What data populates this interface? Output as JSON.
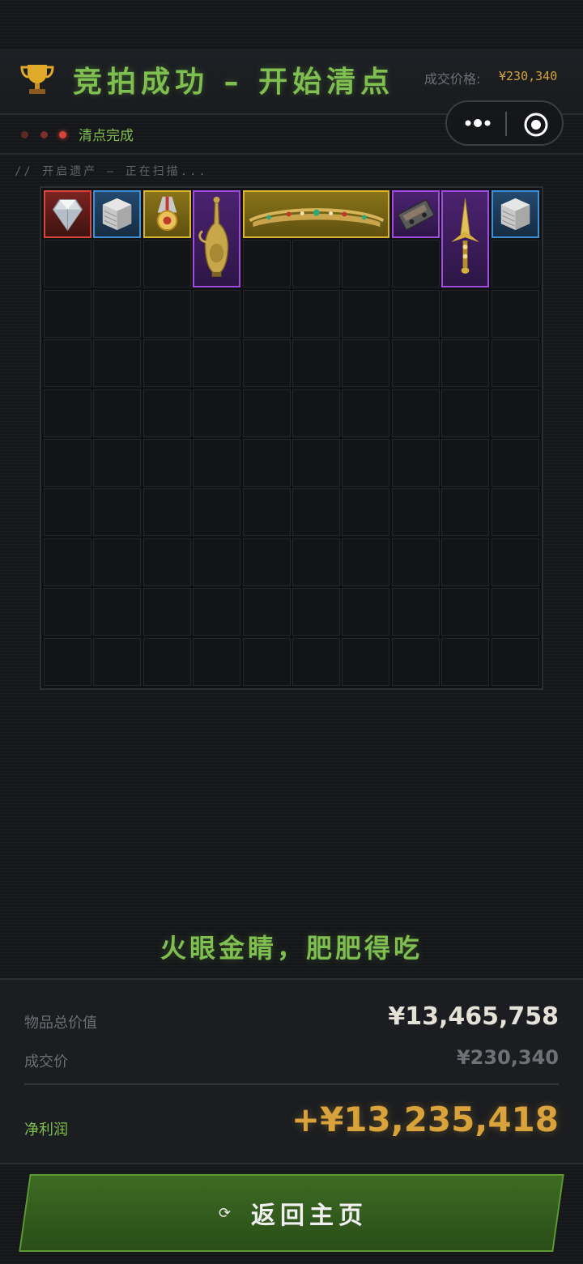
{
  "header": {
    "title": "竞拍成功 – 开始清点",
    "price_label": "成交价格:",
    "price_value": "¥230,340",
    "trophy_icon": "trophy-icon"
  },
  "capsule": {
    "more_icon": "more-dots-icon",
    "target_icon": "target-icon"
  },
  "status": {
    "text": "清点完成",
    "dots": [
      "#5a2a28",
      "#7a2f2b",
      "#d8443a"
    ]
  },
  "scan_text": "//  开启遗产  –  正在扫描...",
  "grid": {
    "columns": 10,
    "rows": 10,
    "items": [
      {
        "name": "diamond-item",
        "icon": "diamond-icon",
        "rarity": "red",
        "col": 0,
        "row": 0,
        "w": 1,
        "h": 1
      },
      {
        "name": "server-box-item",
        "icon": "server-box-icon",
        "rarity": "blue",
        "col": 1,
        "row": 0,
        "w": 1,
        "h": 1
      },
      {
        "name": "medal-item",
        "icon": "medal-icon",
        "rarity": "gold",
        "col": 2,
        "row": 0,
        "w": 1,
        "h": 1
      },
      {
        "name": "ewer-item",
        "icon": "ewer-icon",
        "rarity": "purple",
        "col": 3,
        "row": 0,
        "w": 1,
        "h": 2
      },
      {
        "name": "tiara-item",
        "icon": "tiara-icon",
        "rarity": "gold",
        "col": 4,
        "row": 0,
        "w": 3,
        "h": 1
      },
      {
        "name": "cassette-item",
        "icon": "cassette-icon",
        "rarity": "purple",
        "col": 7,
        "row": 0,
        "w": 1,
        "h": 1
      },
      {
        "name": "dagger-item",
        "icon": "dagger-icon",
        "rarity": "purple",
        "col": 8,
        "row": 0,
        "w": 1,
        "h": 2
      },
      {
        "name": "server-box-item-2",
        "icon": "server-box-icon",
        "rarity": "blue",
        "col": 9,
        "row": 0,
        "w": 1,
        "h": 1
      }
    ]
  },
  "slogan": "火眼金睛，肥肥得吃",
  "summary": {
    "total_label": "物品总价值",
    "total_value": "¥13,465,758",
    "deal_label": "成交价",
    "deal_value": "¥230,340",
    "profit_label": "净利润",
    "profit_value": "+¥13,235,418"
  },
  "home_button": {
    "label": "返回主页",
    "icon": "refresh-icon"
  },
  "colors": {
    "accent_green": "#7fbf4f",
    "gold": "#d9a23a",
    "red": "#d9463c",
    "blue": "#3f8fd6",
    "purple": "#a24be0"
  }
}
